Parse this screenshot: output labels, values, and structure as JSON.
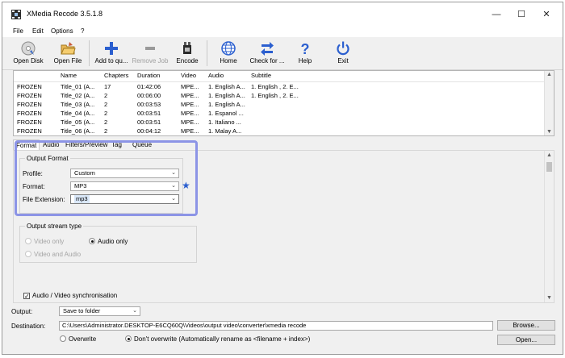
{
  "window": {
    "title": "XMedia Recode 3.5.1.8",
    "minimize_glyph": "—",
    "maximize_glyph": "☐",
    "close_glyph": "✕"
  },
  "menu": [
    "File",
    "Edit",
    "Options",
    "?"
  ],
  "toolbar": {
    "open_disk": "Open Disk",
    "open_file": "Open File",
    "add_to_queue": "Add to qu...",
    "remove_job": "Remove Job",
    "encode": "Encode",
    "home": "Home",
    "check_for": "Check for ...",
    "help": "Help",
    "exit": "Exit"
  },
  "grid": {
    "headers": {
      "source": "",
      "name": "Name",
      "chapters": "Chapters",
      "duration": "Duration",
      "video": "Video",
      "audio": "Audio",
      "subtitle": "Subtitle"
    },
    "rows": [
      {
        "source": "FROZEN",
        "name": "Title_01 (A...",
        "chapters": "17",
        "duration": "01:42:06",
        "video": "MPE...",
        "audio": "1. English A...",
        "subtitle": "1. English , 2. E..."
      },
      {
        "source": "FROZEN",
        "name": "Title_02 (A...",
        "chapters": "2",
        "duration": "00:06:00",
        "video": "MPE...",
        "audio": "1. English A...",
        "subtitle": "1. English , 2. E..."
      },
      {
        "source": "FROZEN",
        "name": "Title_03 (A...",
        "chapters": "2",
        "duration": "00:03:53",
        "video": "MPE...",
        "audio": "1. English A...",
        "subtitle": ""
      },
      {
        "source": "FROZEN",
        "name": "Title_04 (A...",
        "chapters": "2",
        "duration": "00:03:51",
        "video": "MPE...",
        "audio": "1. Espanol ...",
        "subtitle": ""
      },
      {
        "source": "FROZEN",
        "name": "Title_05 (A...",
        "chapters": "2",
        "duration": "00:03:51",
        "video": "MPE...",
        "audio": "1. Italiano ...",
        "subtitle": ""
      },
      {
        "source": "FROZEN",
        "name": "Title_06 (A...",
        "chapters": "2",
        "duration": "00:04:12",
        "video": "MPE...",
        "audio": "1. Malay A...",
        "subtitle": ""
      }
    ],
    "scroll_up": "▲",
    "scroll_down": "▼"
  },
  "tabs": [
    "Format",
    "Audio",
    "Filters/Preview",
    "Tag",
    "Queue"
  ],
  "output_format": {
    "group_title": "Output Format",
    "profile_label": "Profile:",
    "profile_value": "Custom",
    "format_label": "Format:",
    "format_value": "MP3",
    "extension_label": "File Extension:",
    "extension_value": "mp3",
    "favorite_glyph": "★"
  },
  "stream_type": {
    "group_title": "Output stream type",
    "video_only": "Video only",
    "audio_only": "Audio only",
    "video_and_audio": "Video and Audio"
  },
  "sync": {
    "label": "Audio / Video synchronisation",
    "check_glyph": "✓"
  },
  "bottom": {
    "output_label": "Output:",
    "output_value": "Save to folder",
    "destination_label": "Destination:",
    "destination_value": "C:\\Users\\Administrator.DESKTOP-E6CQ60Q\\Videos\\output video\\converter\\xmedia recode",
    "browse": "Browse...",
    "overwrite": "Overwrite",
    "dont_overwrite": "Don't overwrite (Automatically rename as <filename + index>)",
    "open": "Open..."
  },
  "colors": {
    "highlight": "#8c94e6",
    "plus_blue": "#2b5fcf",
    "star_blue": "#2b5fcf"
  }
}
